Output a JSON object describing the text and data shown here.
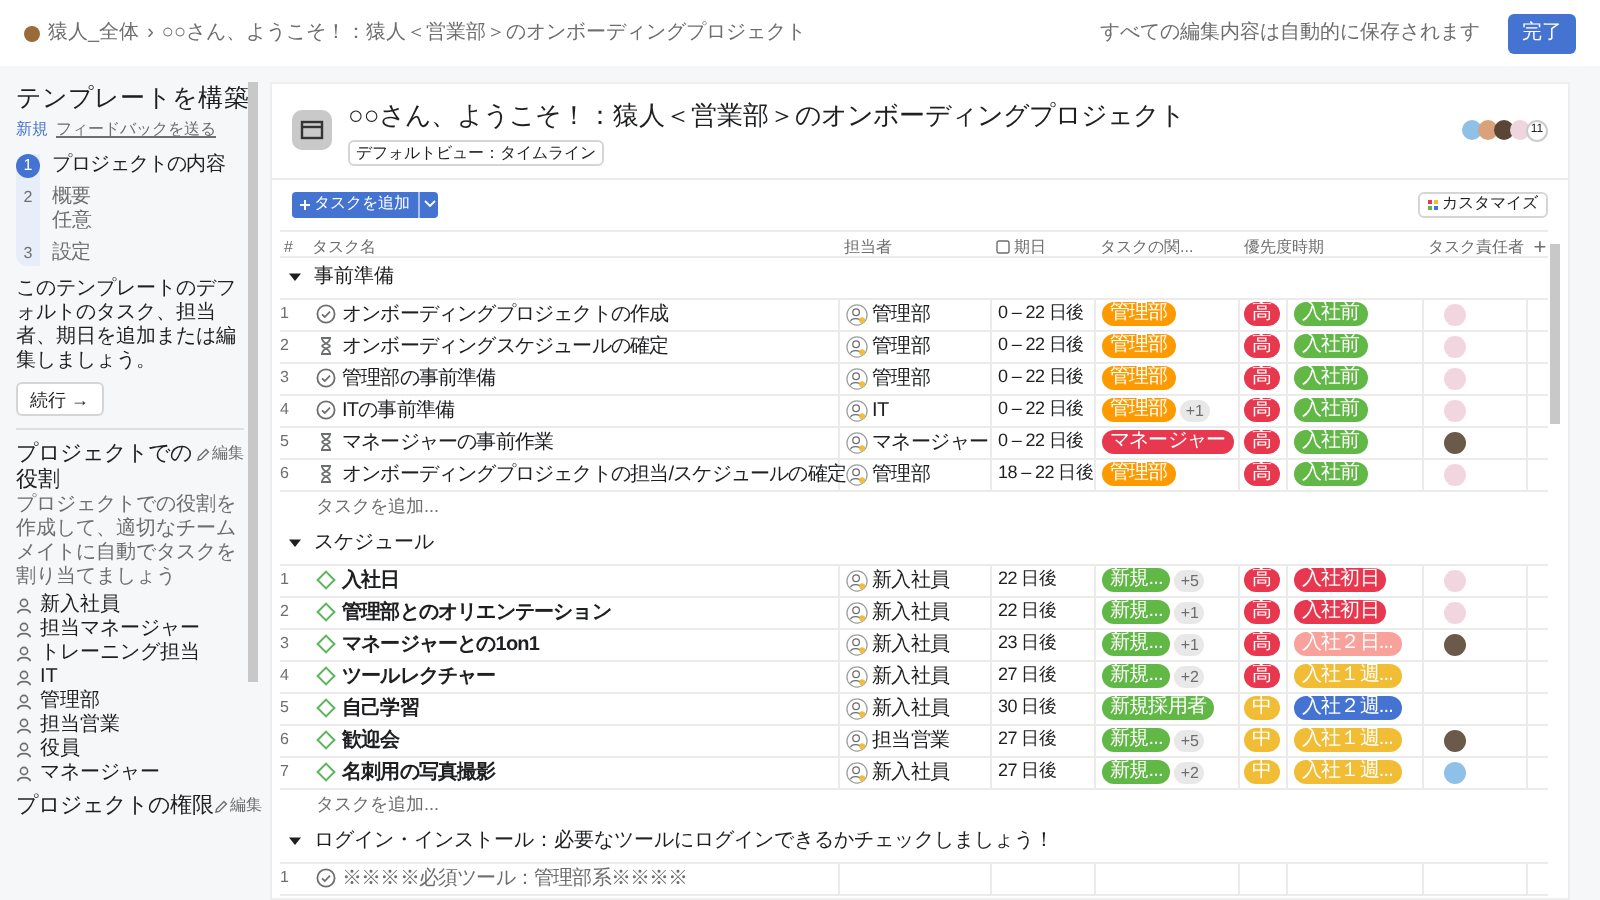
{
  "top_bar": {
    "breadcrumb": [
      "猿人_全体",
      "○○さん、ようこそ！：猿人＜営業部＞のオンボーディングプロジェクト"
    ],
    "separator": "›",
    "autosave": "すべての編集内容は自動的に保存されます",
    "done_button": "完了"
  },
  "sidebar": {
    "title": "テンプレートを構築",
    "badge": "新規",
    "feedback_link": "フィードバックを送る",
    "steps": [
      {
        "number": "1",
        "label": "プロジェクトの内容",
        "selected": true
      },
      {
        "number": "2",
        "label": "概要",
        "sub": "任意",
        "selected": false
      },
      {
        "number": "3",
        "label": "設定",
        "selected": false
      }
    ],
    "description": "このテンプレートのデフォルトのタスク、担当者、期日を追加または編集しましょう。",
    "continue_button": "続行 →",
    "roles_title": "プロジェクトでの役割",
    "edit_label": "編集",
    "roles_description": "プロジェクトでの役割を作成して、適切なチームメイトに自動でタスクを割り当てましょう",
    "roles": [
      "新入社員",
      "担当マネージャー",
      "トレーニング担当",
      "IT",
      "管理部",
      "担当営業",
      "役員",
      "マネージャー"
    ],
    "permissions_title": "プロジェクトの権限",
    "permissions_edit": "編集"
  },
  "project": {
    "title": "○○さん、ようこそ！：猿人＜営業部＞のオンボーディングプロジェクト",
    "default_view": "デフォルトビュー：タイムライン",
    "members": [
      {
        "color": "#8fc1e8"
      },
      {
        "color": "#d9a27a"
      },
      {
        "color": "#5a4636"
      },
      {
        "color": "#efd5dc"
      }
    ],
    "member_count": "11",
    "add_task_button": "タスクを追加",
    "customize_button": "カスタマイズ"
  },
  "table": {
    "columns": [
      "#",
      "タスク名",
      "担当者",
      "期日",
      "タスクの関...",
      "優先度",
      "時期",
      "タスク責任者",
      "+"
    ],
    "sections": [
      {
        "name": "事前準備",
        "expanded": true,
        "add_task": "タスクを追加...",
        "rows": [
          {
            "number": "1",
            "kind": "check",
            "name": "オンボーディングプロジェクトの作成",
            "assignee": "管理部",
            "due": "0 – 22 日後",
            "category": {
              "label": "管理部",
              "color": "#fd9a00"
            },
            "category_more": "",
            "priority": {
              "label": "高",
              "color": "#e8384f"
            },
            "period": {
              "label": "入社前",
              "color": "#62b847"
            },
            "owner": {
              "color": "#f2d6df"
            }
          },
          {
            "number": "2",
            "kind": "hourglass",
            "name": "オンボーディングスケジュールの確定",
            "assignee": "管理部",
            "due": "0 – 22 日後",
            "category": {
              "label": "管理部",
              "color": "#fd9a00"
            },
            "category_more": "",
            "priority": {
              "label": "高",
              "color": "#e8384f"
            },
            "period": {
              "label": "入社前",
              "color": "#62b847"
            },
            "owner": {
              "color": "#f2d6df"
            }
          },
          {
            "number": "3",
            "kind": "check",
            "name": "管理部の事前準備",
            "assignee": "管理部",
            "due": "0 – 22 日後",
            "category": {
              "label": "管理部",
              "color": "#fd9a00"
            },
            "category_more": "",
            "priority": {
              "label": "高",
              "color": "#e8384f"
            },
            "period": {
              "label": "入社前",
              "color": "#62b847"
            },
            "owner": {
              "color": "#f2d6df"
            }
          },
          {
            "number": "4",
            "kind": "check",
            "name": "ITの事前準備",
            "assignee": "IT",
            "due": "0 – 22 日後",
            "category": {
              "label": "管理部",
              "color": "#fd9a00"
            },
            "category_more": "+1",
            "priority": {
              "label": "高",
              "color": "#e8384f"
            },
            "period": {
              "label": "入社前",
              "color": "#62b847"
            },
            "owner": {
              "color": "#f2d6df"
            }
          },
          {
            "number": "5",
            "kind": "hourglass",
            "name": "マネージャーの事前作業",
            "assignee": "マネージャー",
            "due": "0 – 22 日後",
            "category": {
              "label": "マネージャー",
              "color": "#e8384f"
            },
            "category_more": "",
            "priority": {
              "label": "高",
              "color": "#e8384f"
            },
            "period": {
              "label": "入社前",
              "color": "#62b847"
            },
            "owner": {
              "color": "#6b5a4a"
            }
          },
          {
            "number": "6",
            "kind": "hourglass",
            "name": "オンボーディングプロジェクトの担当/スケジュールの確定",
            "assignee": "管理部",
            "due": "18 – 22 日後",
            "category": {
              "label": "管理部",
              "color": "#fd9a00"
            },
            "category_more": "",
            "priority": {
              "label": "高",
              "color": "#e8384f"
            },
            "period": {
              "label": "入社前",
              "color": "#62b847"
            },
            "owner": {
              "color": "#f2d6df"
            }
          }
        ]
      },
      {
        "name": "スケジュール",
        "expanded": true,
        "add_task": "タスクを追加...",
        "rows": [
          {
            "number": "1",
            "kind": "milestone",
            "name": "入社日",
            "assignee": "新入社員",
            "due": "22 日後",
            "category": {
              "label": "新規...",
              "color": "#62b847"
            },
            "category_more": "+5",
            "priority": {
              "label": "高",
              "color": "#e8384f"
            },
            "period": {
              "label": "入社初日",
              "color": "#e8384f"
            },
            "owner": {
              "color": "#f2d6df"
            }
          },
          {
            "number": "2",
            "kind": "milestone",
            "name": "管理部とのオリエンテーション",
            "assignee": "新入社員",
            "due": "22 日後",
            "category": {
              "label": "新規...",
              "color": "#62b847"
            },
            "category_more": "+1",
            "priority": {
              "label": "高",
              "color": "#e8384f"
            },
            "period": {
              "label": "入社初日",
              "color": "#e8384f"
            },
            "owner": {
              "color": "#f2d6df"
            }
          },
          {
            "number": "3",
            "kind": "milestone",
            "name": "マネージャーとの1on1",
            "assignee": "新入社員",
            "due": "23 日後",
            "category": {
              "label": "新規...",
              "color": "#62b847"
            },
            "category_more": "+1",
            "priority": {
              "label": "高",
              "color": "#e8384f"
            },
            "period": {
              "label": "入社２日...",
              "color": "#f9a29c"
            },
            "owner": {
              "color": "#6b5a4a"
            }
          },
          {
            "number": "4",
            "kind": "milestone",
            "name": "ツールレクチャー",
            "assignee": "新入社員",
            "due": "27 日後",
            "category": {
              "label": "新規...",
              "color": "#62b847"
            },
            "category_more": "+2",
            "priority": {
              "label": "高",
              "color": "#e8384f"
            },
            "period": {
              "label": "入社１週...",
              "color": "#f1bd35"
            }
          },
          {
            "number": "5",
            "kind": "milestone",
            "name": "自己学習",
            "assignee": "新入社員",
            "due": "30 日後",
            "category": {
              "label": "新規採用者",
              "color": "#62b847"
            },
            "category_more": "",
            "priority": {
              "label": "中",
              "color": "#f1bd35"
            },
            "period": {
              "label": "入社２週...",
              "color": "#4573d2"
            }
          },
          {
            "number": "6",
            "kind": "milestone",
            "name": "歓迎会",
            "assignee": "担当営業",
            "due": "27 日後",
            "category": {
              "label": "新規...",
              "color": "#62b847"
            },
            "category_more": "+5",
            "priority": {
              "label": "中",
              "color": "#f1bd35"
            },
            "period": {
              "label": "入社１週...",
              "color": "#f1bd35"
            },
            "owner": {
              "color": "#6b5a4a"
            }
          },
          {
            "number": "7",
            "kind": "milestone",
            "name": "名刺用の写真撮影",
            "assignee": "新入社員",
            "due": "27 日後",
            "category": {
              "label": "新規...",
              "color": "#62b847"
            },
            "category_more": "+2",
            "priority": {
              "label": "中",
              "color": "#f1bd35"
            },
            "period": {
              "label": "入社１週...",
              "color": "#f1bd35"
            },
            "owner": {
              "color": "#8fc1e8"
            }
          }
        ]
      },
      {
        "name": "ログイン・インストール：必要なツールにログインできるかチェックしましょう！",
        "expanded": true,
        "rows": [
          {
            "number": "1",
            "kind": "note",
            "name": "※※※※必須ツール：管理部系※※※※"
          }
        ]
      }
    ]
  }
}
